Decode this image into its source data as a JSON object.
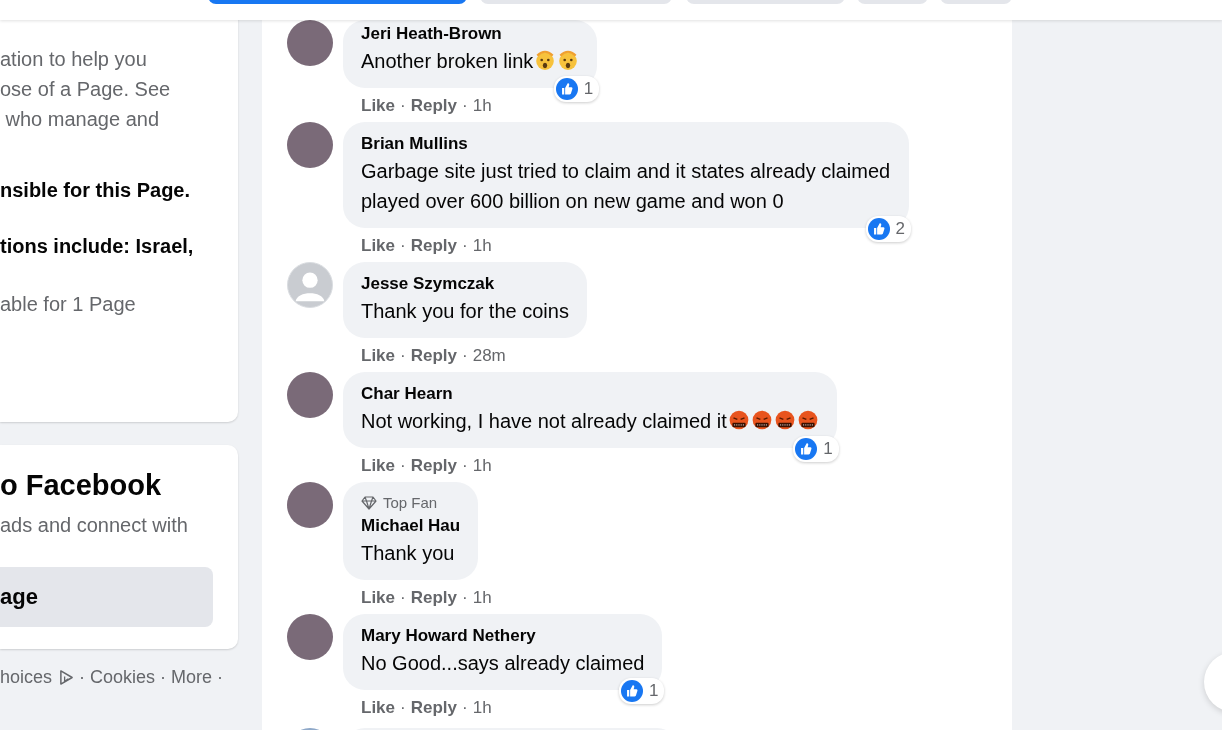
{
  "header_buttons": [
    {
      "selected": true
    },
    {
      "selected": false
    },
    {
      "selected": false
    },
    {
      "selected": false
    },
    {
      "selected": false
    }
  ],
  "about_card": {
    "paragraphs": [
      {
        "kind": "muted",
        "lines": [
          "ation to help you",
          "ose of a Page. See",
          " who manage and"
        ]
      },
      {
        "kind": "strong",
        "lines": [
          "nsible for this Page."
        ]
      },
      {
        "kind": "strong",
        "lines": [
          "tions include: Israel,"
        ]
      },
      {
        "kind": "muted",
        "lines": [
          "able for 1 Page"
        ]
      }
    ]
  },
  "signup_card": {
    "title": "o Facebook",
    "subtitle": "ads and connect with",
    "button": "age"
  },
  "footer": {
    "before": "hoices",
    "links": [
      {
        "sep": "·",
        "label": "Cookies"
      },
      {
        "sep": "·",
        "label": "More"
      }
    ],
    "end": "·"
  },
  "comments": [
    {
      "name": "Jeri Heath-Brown",
      "avatar": {
        "kind": "photo"
      },
      "text": "Another broken link",
      "emojis": [
        {
          "kind": "shocked"
        },
        {
          "kind": "shocked"
        }
      ],
      "likes": "1",
      "time": "1h",
      "actions": [
        {
          "label": "Like",
          "sep": "·"
        },
        {
          "label": "Reply",
          "sep": "·"
        }
      ]
    },
    {
      "name": "Brian Mullins",
      "avatar": {
        "kind": "photo"
      },
      "text": "Garbage site just tried to claim and it states already claimed played over 600 billion on new game and won 0",
      "likes": "2",
      "time": "1h",
      "actions": [
        {
          "label": "Like",
          "sep": "·"
        },
        {
          "label": "Reply",
          "sep": "·"
        }
      ]
    },
    {
      "name": "Jesse Szymczak",
      "avatar": {
        "kind": "default"
      },
      "text": "Thank you for the coins",
      "time": "28m",
      "actions": [
        {
          "label": "Like",
          "sep": "·"
        },
        {
          "label": "Reply",
          "sep": "·"
        }
      ]
    },
    {
      "name": "Char Hearn",
      "avatar": {
        "kind": "photo"
      },
      "text": "Not working, I have not already claimed it",
      "emojis": [
        {
          "kind": "cursing"
        },
        {
          "kind": "cursing"
        },
        {
          "kind": "cursing"
        },
        {
          "kind": "cursing"
        }
      ],
      "likes": "1",
      "time": "1h",
      "actions": [
        {
          "label": "Like",
          "sep": "·"
        },
        {
          "label": "Reply",
          "sep": "·"
        }
      ]
    },
    {
      "name": "Michael Hau",
      "badge": "Top Fan",
      "avatar": {
        "kind": "photo"
      },
      "text": "Thank you",
      "time": "1h",
      "actions": [
        {
          "label": "Like",
          "sep": "·"
        },
        {
          "label": "Reply",
          "sep": "·"
        }
      ]
    },
    {
      "name": "Mary Howard Nethery",
      "avatar": {
        "kind": "photo"
      },
      "text": "No Good...says already claimed",
      "likes": "1",
      "time": "1h",
      "actions": [
        {
          "label": "Like",
          "sep": "·"
        },
        {
          "label": "Reply",
          "sep": "·"
        }
      ]
    }
  ]
}
